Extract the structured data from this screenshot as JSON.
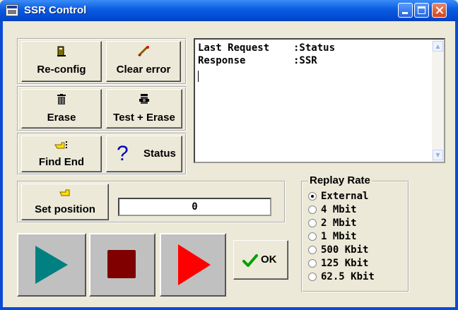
{
  "window": {
    "title": "SSR Control"
  },
  "buttons": {
    "reconfig": "Re-config",
    "clear_error": "Clear error",
    "erase": "Erase",
    "test_erase": "Test + Erase",
    "find_end": "Find End",
    "status": "Status",
    "set_position": "Set position",
    "ok": "OK"
  },
  "response": {
    "lines": [
      {
        "key": "Last Request",
        "value": ":Status"
      },
      {
        "key": "Response",
        "value": ":SSR"
      }
    ]
  },
  "position": {
    "value": "0"
  },
  "replay_rate": {
    "title": "Replay Rate",
    "selected": "External",
    "options": [
      "External",
      "4 Mbit",
      "2 Mbit",
      "1 Mbit",
      "500 Kbit",
      "125 Kbit",
      "62.5 Kbit"
    ]
  },
  "icons": {
    "reconfig": "pc-tower-icon",
    "clear_error": "eraser-icon",
    "erase": "trash-can-icon",
    "test_erase": "trash-test-icon",
    "find_end": "hand-pointer-end-icon",
    "status": "question-icon",
    "set_position": "hand-pointer-icon",
    "ok": "checkmark-icon",
    "play": "play-icon",
    "stop": "stop-icon",
    "record": "record-play-icon"
  },
  "colors": {
    "titlebar": "#0A5BE0",
    "play": "#008080",
    "stop": "#800000",
    "record": "#FF0000",
    "ok_check": "#00A000"
  }
}
